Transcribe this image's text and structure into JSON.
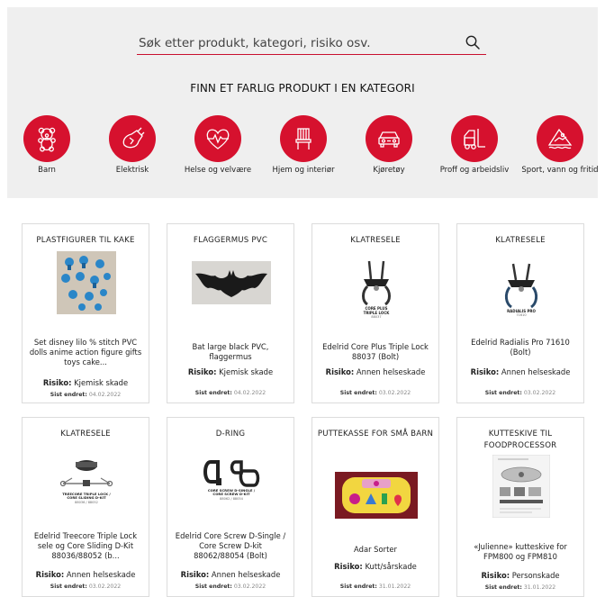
{
  "search": {
    "placeholder": "Søk etter produkt, kategori, risiko osv."
  },
  "heading": "FINN ET FARLIG PRODUKT I EN KATEGORI",
  "accent_color": "#d6112e",
  "categories": [
    {
      "label": "Barn",
      "icon": "teddy-bear-icon"
    },
    {
      "label": "Elektrisk",
      "icon": "power-plug-icon"
    },
    {
      "label": "Helse og velvære",
      "icon": "heart-pulse-icon"
    },
    {
      "label": "Hjem og interiør",
      "icon": "chair-icon"
    },
    {
      "label": "Kjøretøy",
      "icon": "car-icon"
    },
    {
      "label": "Proff og arbeidsliv",
      "icon": "forklift-icon"
    },
    {
      "label": "Sport, vann og fritid",
      "icon": "sports-icon"
    }
  ],
  "risk_label": "Risiko:",
  "updated_label": "Sist endret:",
  "products": [
    {
      "title": "PLASTFIGURER TIL KAKE",
      "description": "Set disney lilo % stitch PVC dolls anime action figure gifts toys cake...",
      "risk": "Kjemisk skade",
      "updated": "04.02.2022",
      "image": "stitch-figures-image"
    },
    {
      "title": "FLAGGERMUS PVC",
      "description": "Bat large black PVC, flaggermus",
      "risk": "Kjemisk skade",
      "updated": "04.02.2022",
      "image": "bat-image"
    },
    {
      "title": "KLATRESELE",
      "description": "Edelrid Core Plus Triple Lock 88037 (Bolt)",
      "risk": "Annen helseskade",
      "updated": "03.02.2022",
      "image": "harness-image",
      "image_caption": "CORE PLUS TRIPLE LOCK",
      "image_caption_2": "88037"
    },
    {
      "title": "KLATRESELE",
      "description": "Edelrid Radialis Pro 71610 (Bolt)",
      "risk": "Annen helseskade",
      "updated": "03.02.2022",
      "image": "harness-image",
      "image_caption": "RADIALIS PRO",
      "image_caption_2": "71610"
    },
    {
      "title": "KLATRESELE",
      "description": "Edelrid Treecore Triple Lock sele og Core Sliding D-Kit 88036/88052 (b...",
      "risk": "Annen helseskade",
      "updated": "03.02.2022",
      "image": "tree-harness-image",
      "image_caption": "TREECORE TRIPLE LOCK / CORE SLIDING D-KIT",
      "image_caption_2": "88036 / 88052"
    },
    {
      "title": "D-RING",
      "description": "Edelrid Core Screw D-Single / Core Screw D-kit 88062/88054 (Bolt)",
      "risk": "Annen helseskade",
      "updated": "03.02.2022",
      "image": "d-ring-image",
      "image_caption": "CORE SCREW D-SINGLE / CORE SCREW D-KIT",
      "image_caption_2": "88062 / 88054"
    },
    {
      "title": "PUTTEKASSE FOR SMÅ BARN",
      "description": "Adar Sorter",
      "risk": "Kutt/sårskade",
      "updated": "31.01.2022",
      "image": "shape-sorter-image"
    },
    {
      "title": "KUTTESKIVE TIL FOODPROCESSOR",
      "description": "«Julienne» kutteskive for FPM800 og FPM810",
      "risk": "Personskade",
      "updated": "31.01.2022",
      "image": "cutting-disc-image"
    }
  ]
}
